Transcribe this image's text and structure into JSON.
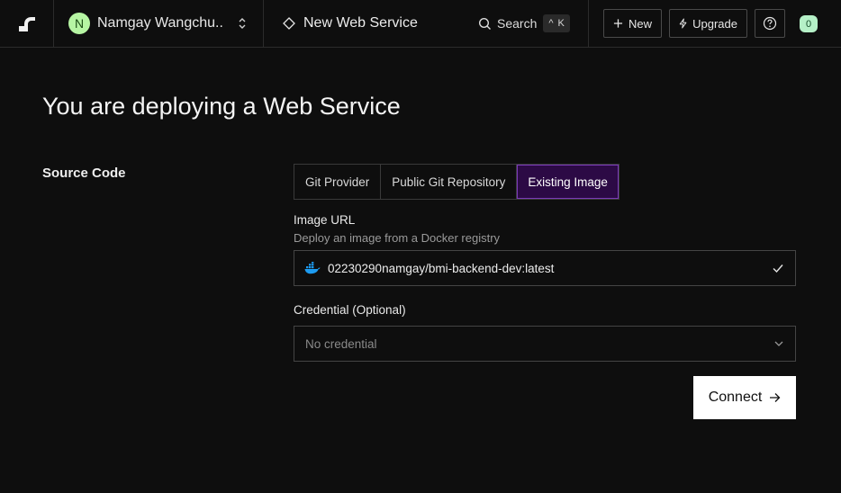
{
  "nav": {
    "workspace": {
      "initial": "N",
      "name": "Namgay Wangchu..."
    },
    "page_title": "New Web Service",
    "search": {
      "label": "Search",
      "shortcut_modifier": "^",
      "shortcut_key": "K"
    },
    "new_label": "New",
    "upgrade_label": "Upgrade",
    "notification_count": "0"
  },
  "main": {
    "heading": "You are deploying a Web Service",
    "section_label": "Source Code",
    "tabs": [
      {
        "label": "Git Provider",
        "active": false
      },
      {
        "label": "Public Git Repository",
        "active": false
      },
      {
        "label": "Existing Image",
        "active": true
      }
    ],
    "image_url": {
      "label": "Image URL",
      "help": "Deploy an image from a Docker registry",
      "value": "02230290namgay/bmi-backend-dev:latest",
      "icon": "docker-icon"
    },
    "credential": {
      "label": "Credential (Optional)",
      "placeholder": "No credential"
    },
    "connect_label": "Connect"
  },
  "colors": {
    "background": "#0e0e0e",
    "active_tab_bg": "#2c0a45",
    "avatar_bg": "#b6f5a3",
    "badge_bg": "#b5f0c7",
    "docker_blue": "#1d9bf0"
  }
}
